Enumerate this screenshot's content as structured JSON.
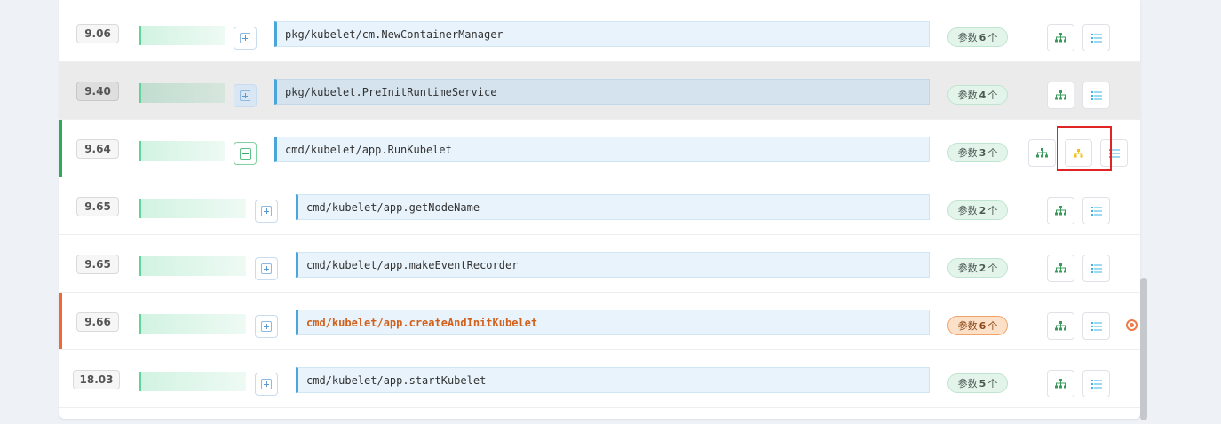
{
  "colors": {
    "accent_green": "#2eaa5a",
    "accent_orange": "#ee6a35",
    "highlight_text": "#d3601a",
    "red_annotation": "#e02424"
  },
  "rows": [
    {
      "score": "9.06",
      "expand_icon": "expand-plus-icon",
      "function": "pkg/kubelet/cm.NewContainerManager",
      "params_label": "参数",
      "params_count": "6",
      "params_unit": "个",
      "indent": 0
    },
    {
      "score": "9.40",
      "expand_icon": "expand-plus-icon",
      "function": "pkg/kubelet.PreInitRuntimeService",
      "params_label": "参数",
      "params_count": "4",
      "params_unit": "个",
      "indent": 0,
      "state": "hovered"
    },
    {
      "score": "9.64",
      "expand_icon": "collapse-minus-icon",
      "function": "cmd/kubelet/app.RunKubelet",
      "params_label": "参数",
      "params_count": "3",
      "params_unit": "个",
      "indent": 0,
      "state": "expanded"
    },
    {
      "score": "9.65",
      "expand_icon": "expand-plus-icon",
      "function": "cmd/kubelet/app.getNodeName",
      "params_label": "参数",
      "params_count": "2",
      "params_unit": "个",
      "indent": 1
    },
    {
      "score": "9.65",
      "expand_icon": "expand-plus-icon",
      "function": "cmd/kubelet/app.makeEventRecorder",
      "params_label": "参数",
      "params_count": "2",
      "params_unit": "个",
      "indent": 1
    },
    {
      "score": "9.66",
      "expand_icon": "expand-plus-icon",
      "function": "cmd/kubelet/app.createAndInitKubelet",
      "params_label": "参数",
      "params_count": "6",
      "params_unit": "个",
      "indent": 1,
      "state": "highlighted"
    },
    {
      "score": "18.03",
      "expand_icon": "expand-plus-icon",
      "function": "cmd/kubelet/app.startKubelet",
      "params_label": "参数",
      "params_count": "5",
      "params_unit": "个",
      "indent": 1
    }
  ],
  "row_actions": {
    "tree": "hierarchy-icon",
    "call_graph": "call-graph-icon",
    "list": "list-icon"
  },
  "locate_icon": "locate-target-icon"
}
